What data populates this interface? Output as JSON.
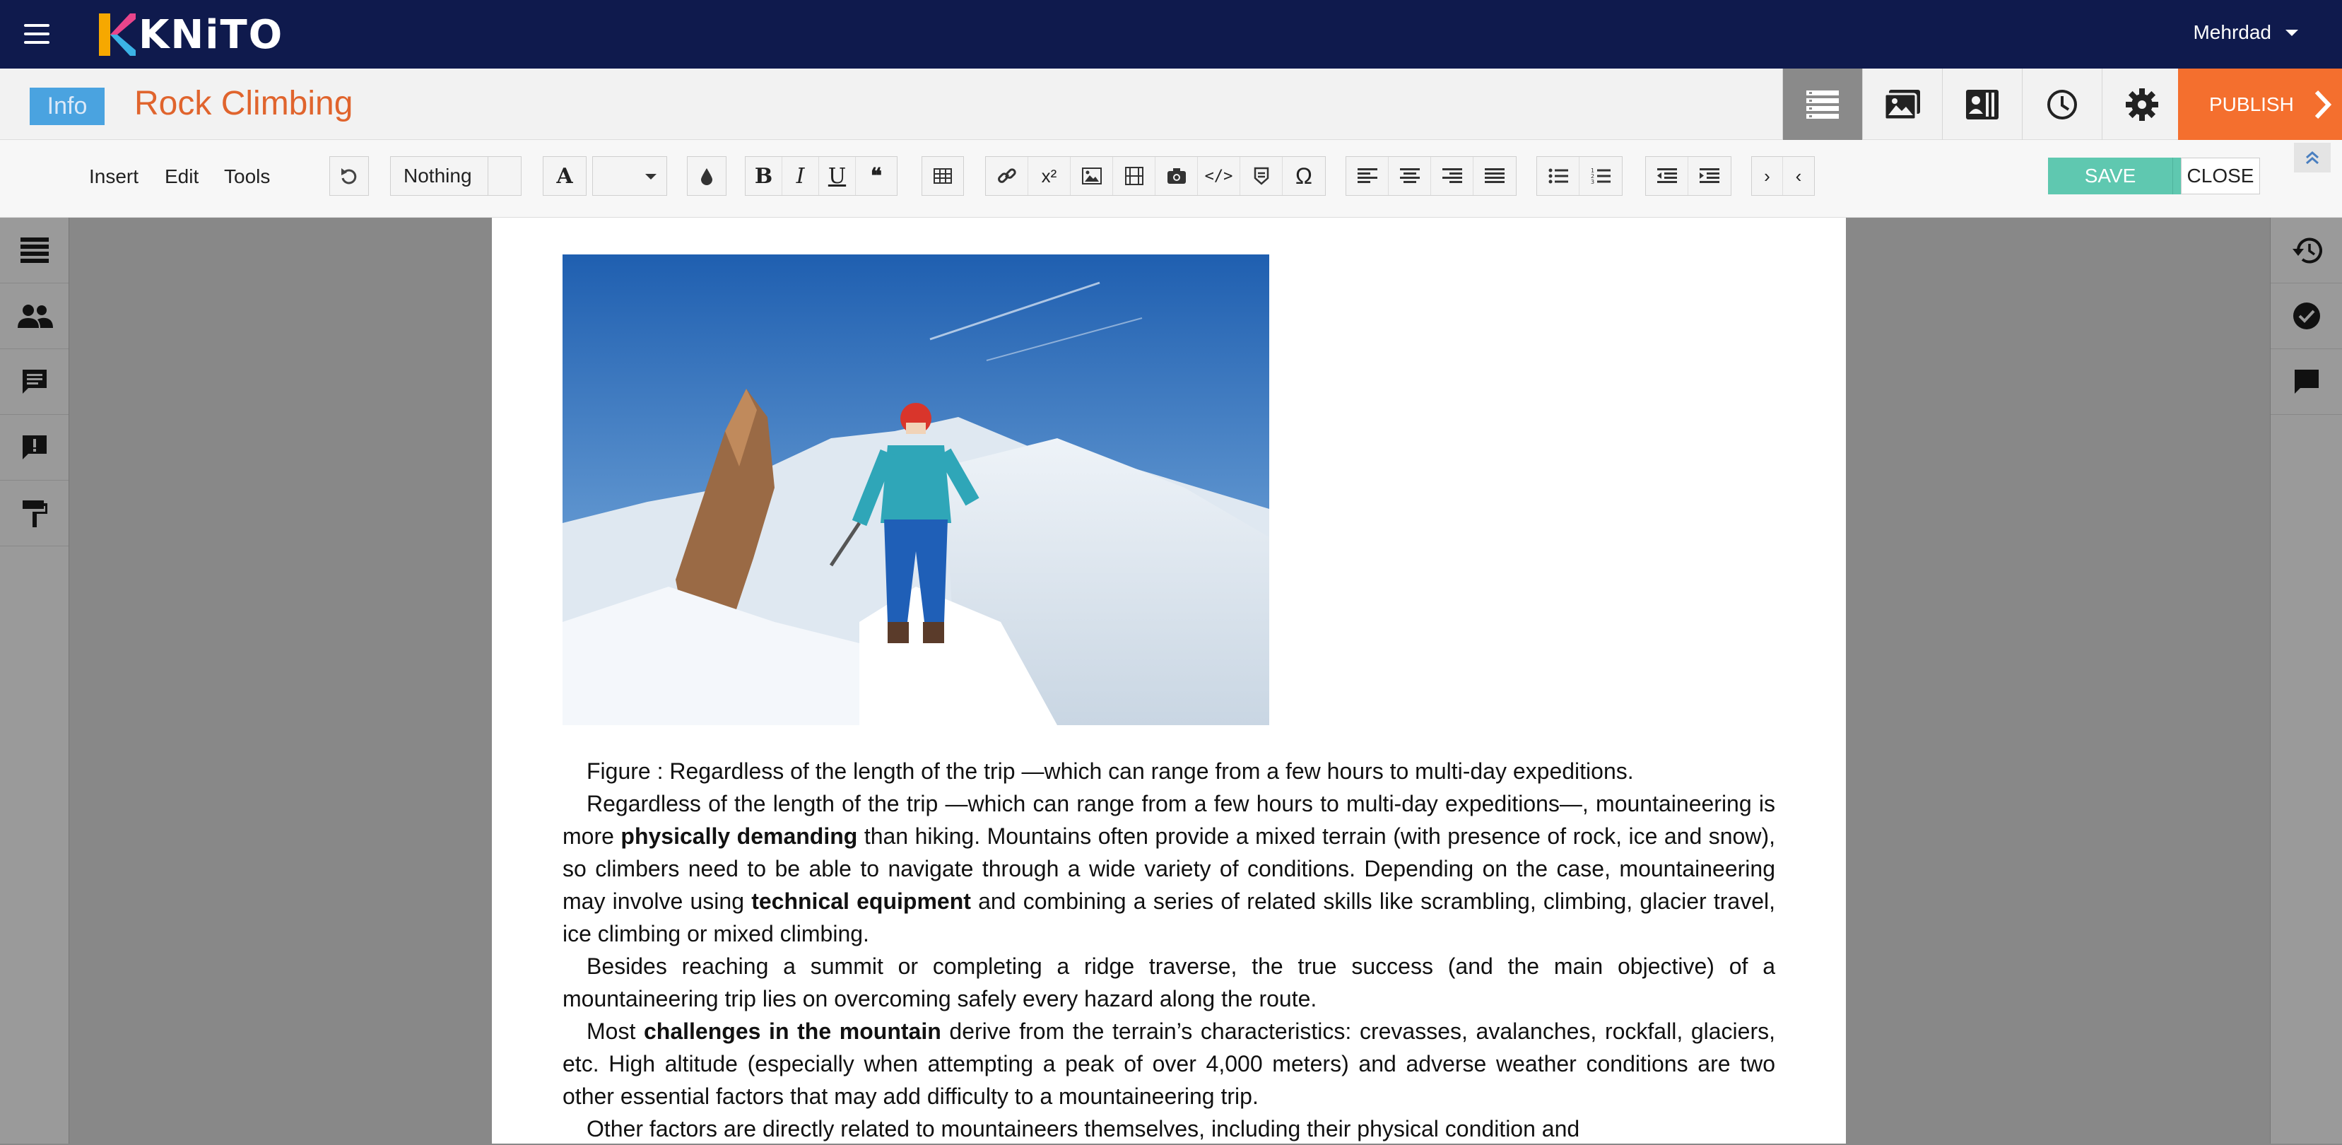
{
  "topbar": {
    "logo_text": "KNiTO",
    "user_name": "Mehrdad"
  },
  "titlebar": {
    "info_label": "Info",
    "document_title": "Rock Climbing",
    "publish_label": "PUBLISH"
  },
  "toolbar": {
    "menus": [
      "Insert",
      "Edit",
      "Tools"
    ],
    "style_select": "Nothing",
    "save_label": "SAVE",
    "close_label": "CLOSE"
  },
  "document": {
    "paragraphs": [
      [
        {
          "t": "Figure : Regardless of the length of the trip —which can range from a few hours to multi-day expeditions."
        }
      ],
      [
        {
          "t": "Regardless of the length of the trip —which can range from a few hours to multi-day expeditions—, mountaineering is more "
        },
        {
          "t": "physically demanding",
          "b": true
        },
        {
          "t": " than hiking. Mountains often provide a mixed terrain (with presence of rock, ice and snow), so climbers need to be able to navigate through a wide variety of conditions. Depending on the case, mountaineering may involve using "
        },
        {
          "t": "technical equipment",
          "b": true
        },
        {
          "t": " and combining a series of related skills like scrambling, climbing, glacier travel, ice climbing or mixed climbing."
        }
      ],
      [
        {
          "t": "Besides reaching a summit or completing a ridge traverse, the true success (and the main objective) of a mountaineering trip lies on overcoming safely every hazard along the route."
        }
      ],
      [
        {
          "t": "Most "
        },
        {
          "t": "challenges in the mountain",
          "b": true
        },
        {
          "t": " derive from the terrain’s characteristics:  crevasses, avalanches, rockfall, glaciers, etc. High altitude (especially when attempting a peak of over 4,000 meters) and adverse weather conditions are two other essential factors that may add difficulty to a mountaineering trip."
        }
      ],
      [
        {
          "t": "Other factors are directly related to mountaineers themselves, including their physical condition and"
        }
      ]
    ]
  },
  "colors": {
    "topbar": "#0f1a4d",
    "title": "#e0642d",
    "publish": "#f46f2e",
    "save": "#5fc8b0",
    "info": "#4aa3e0"
  }
}
